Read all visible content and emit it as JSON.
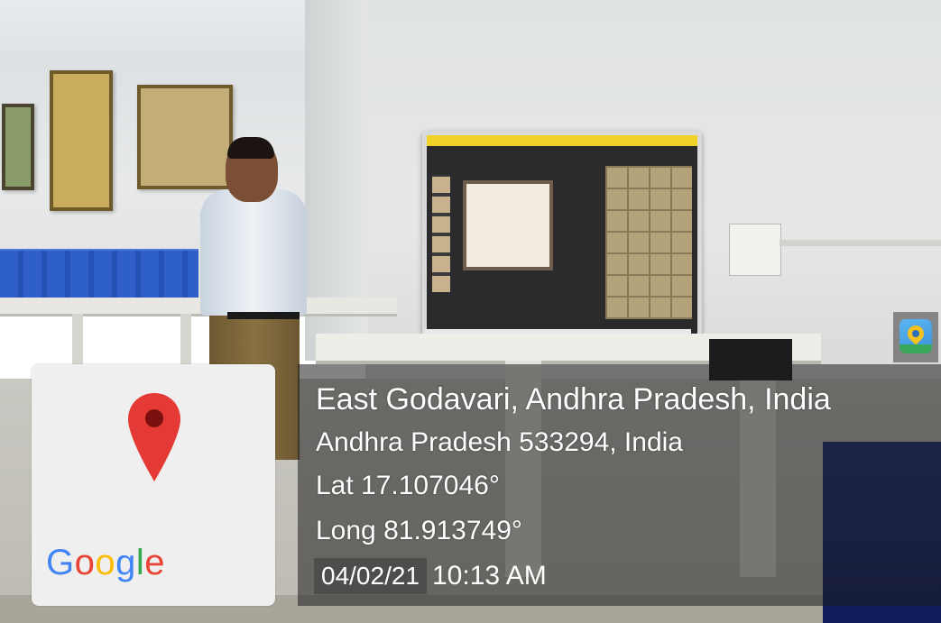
{
  "photo": {
    "icon": "geotagged-classroom-photo"
  },
  "map_card": {
    "pin_icon": "map-pin-icon",
    "pin_color": "#e53935",
    "logo_text": "Google",
    "logo_colors": [
      "#4285f4",
      "#ea4335",
      "#fbbc05",
      "#4285f4",
      "#34a853",
      "#ea4335"
    ]
  },
  "location": {
    "line1": "East Godavari, Andhra Pradesh, India",
    "line2": "Andhra Pradesh 533294, India",
    "latitude": "Lat 17.107046°",
    "longitude": "Long 81.913749°",
    "date": "04/02/21",
    "time": "10:13 AM"
  },
  "app_badge": {
    "icon": "gps-map-camera-icon"
  }
}
